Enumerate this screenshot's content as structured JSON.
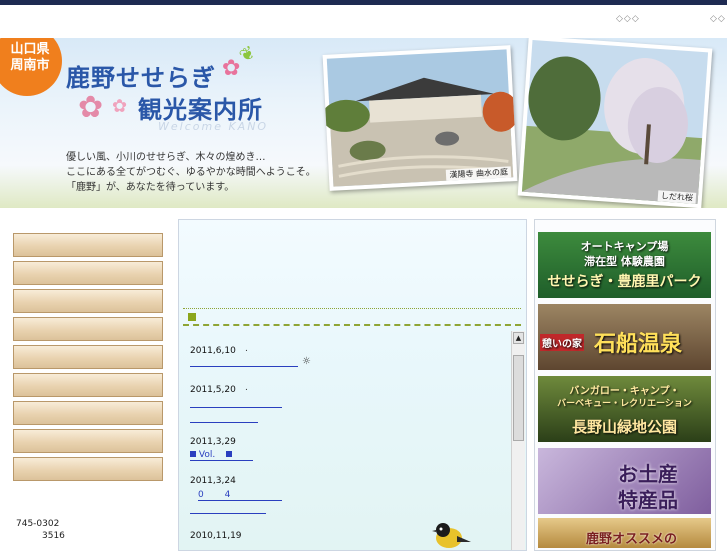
{
  "header": {
    "top_links": [
      "◇◇◇",
      "◇◇"
    ]
  },
  "banner": {
    "badge": "山口県\n周南市",
    "title_line1": "鹿野せせらぎ",
    "title_line2": "観光案内所",
    "welcome": "Welcome KANO",
    "tagline": [
      "優しい風、小川のせせらぎ、木々の煌めき…",
      "ここにある全てがつむぐ、ゆるやかな時間へようこそ。",
      "「鹿野」が、あなたを待っています。"
    ],
    "photo1_caption": "漢陽寺 曲水の庭",
    "photo2_caption": "しだれ桜"
  },
  "left_nav": {
    "items": [
      "",
      "",
      "",
      "",
      "",
      "",
      "",
      "",
      ""
    ]
  },
  "address": {
    "line1": "745-0302",
    "line2": "3516"
  },
  "news": {
    "items": [
      {
        "date": "2011,6,10",
        "link": ""
      },
      {
        "date": "2011,5,20",
        "link": ""
      },
      {
        "date": "2011,3,29",
        "link": "Vol."
      },
      {
        "date": "2011,3,24",
        "link": "0 4"
      },
      {
        "date": "2010,11,19",
        "link": ""
      }
    ]
  },
  "ads": [
    {
      "line1": "オートキャンプ場",
      "line2": "滞在型 体験農園",
      "line3": "せせらぎ・豊鹿里パーク",
      "color": "#2e7d32"
    },
    {
      "line1": "憩いの家",
      "line2": "石船温泉",
      "color": "#7a5a3a"
    },
    {
      "line1": "バンガロー・キャンプ・",
      "line2": "バーベキュー・レクリエーション",
      "line3": "長野山緑地公園",
      "color": "#3e5f1f"
    },
    {
      "line1": "お土産",
      "line2": "特産品",
      "color": "#6a4c8c"
    },
    {
      "line1": "鹿野オススメの",
      "color": "#b07b2a"
    }
  ],
  "colors": {
    "topbar": "#1e2b52",
    "title": "#2a57a8",
    "badge": "#f07f1d",
    "accent_green": "#8ca61c",
    "link_blue": "#2a3fbf"
  }
}
